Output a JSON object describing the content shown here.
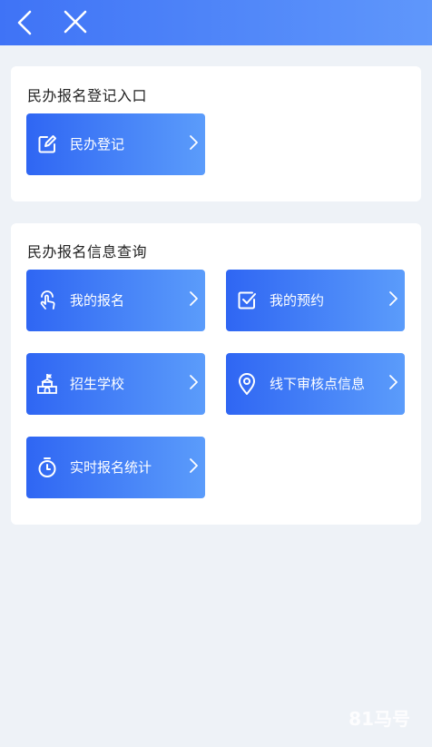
{
  "nav": {
    "back_icon": "chevron-left-icon",
    "close_icon": "close-icon"
  },
  "section_register": {
    "title": "民办报名登记入口",
    "tiles": [
      {
        "label": "民办登记",
        "icon": "edit-icon"
      }
    ]
  },
  "section_query": {
    "title": "民办报名信息查询",
    "tiles": [
      {
        "label": "我的报名",
        "icon": "tap-hand-icon"
      },
      {
        "label": "我的预约",
        "icon": "checkbox-icon"
      },
      {
        "label": "招生学校",
        "icon": "school-icon"
      },
      {
        "label": "线下审核点信息",
        "icon": "location-pin-icon"
      },
      {
        "label": "实时报名统计",
        "icon": "stopwatch-icon"
      }
    ]
  },
  "watermark": "81马号",
  "colors": {
    "accent_start": "#2f66f3",
    "accent_end": "#5b9cfb",
    "background": "#eef2f7"
  }
}
